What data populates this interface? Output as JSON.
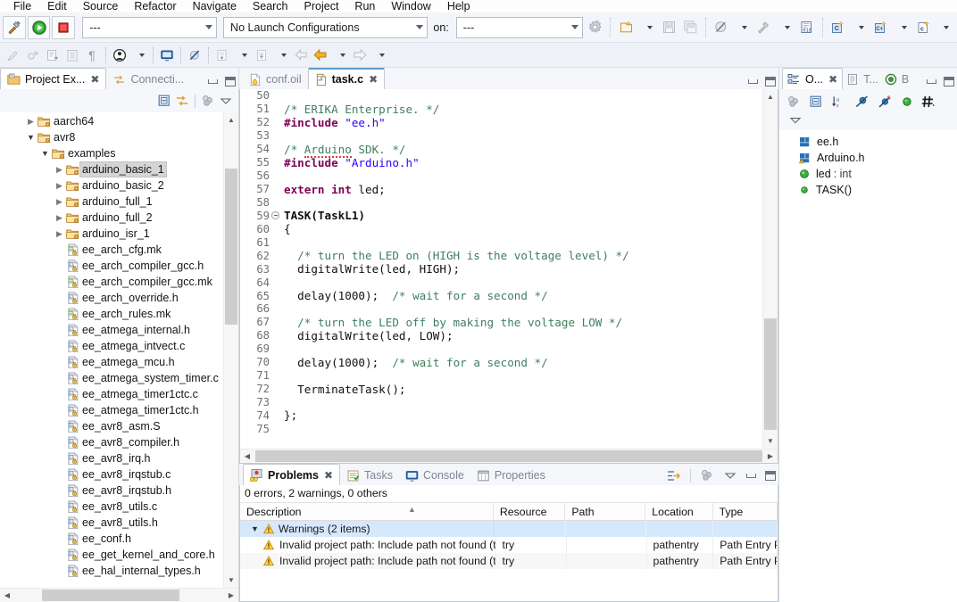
{
  "menubar": {
    "items": [
      "File",
      "Edit",
      "Source",
      "Refactor",
      "Navigate",
      "Search",
      "Project",
      "Run",
      "Window",
      "Help"
    ]
  },
  "toolbar": {
    "build_button": "build-hammer-button",
    "run_button": "run-button",
    "stop_button": "stop-button",
    "active_config": "---",
    "launch_config": "No Launch Configurations",
    "on_label": "on:",
    "on_value": "---",
    "items": [
      "new-wizard-button",
      "save-button",
      "save-all-button",
      "skip-breakpoints-button",
      "build-all-button",
      "toggle-hex-button",
      "new-c-project-button",
      "new-cpp-project-button",
      "new-c-file-button"
    ]
  },
  "toolbar2": {
    "items": [
      "marker-button",
      "new-annotation-button",
      "forward-edit-button",
      "open-type-button",
      "pilcrow-button",
      "user-button",
      "console-button",
      "skip-all-breakpoints-button",
      "previous-annotation-button",
      "next-annotation-button",
      "back-button",
      "previous-edit-button",
      "next-edit-button"
    ]
  },
  "project_explorer": {
    "tabs": [
      {
        "label": "Project Ex...",
        "icon": "project-explorer-icon",
        "active": true,
        "closable": true
      },
      {
        "label": "Connecti...",
        "icon": "connection-icon",
        "active": false,
        "closable": false
      }
    ],
    "toolbar": [
      "collapse-all-icon",
      "link-with-editor-icon",
      "view-filters-icon",
      "view-menu-icon"
    ],
    "minimize": "minimize-button",
    "maximize": "maximize-button",
    "tree": [
      {
        "label": "aarch64",
        "depth": 2,
        "type": "folder",
        "state": "collapsed",
        "selected": false
      },
      {
        "label": "avr8",
        "depth": 2,
        "type": "folder",
        "state": "expanded",
        "selected": false
      },
      {
        "label": "examples",
        "depth": 3,
        "type": "folder",
        "state": "expanded",
        "selected": false
      },
      {
        "label": "arduino_basic_1",
        "depth": 4,
        "type": "folder",
        "state": "collapsed",
        "selected": true
      },
      {
        "label": "arduino_basic_2",
        "depth": 4,
        "type": "folder",
        "state": "collapsed",
        "selected": false
      },
      {
        "label": "arduino_full_1",
        "depth": 4,
        "type": "folder",
        "state": "collapsed",
        "selected": false
      },
      {
        "label": "arduino_full_2",
        "depth": 4,
        "type": "folder",
        "state": "collapsed",
        "selected": false
      },
      {
        "label": "arduino_isr_1",
        "depth": 4,
        "type": "folder",
        "state": "collapsed",
        "selected": false
      },
      {
        "label": "ee_arch_cfg.mk",
        "depth": 4,
        "type": "mk",
        "state": "leaf",
        "selected": false
      },
      {
        "label": "ee_arch_compiler_gcc.h",
        "depth": 4,
        "type": "src",
        "state": "leaf",
        "selected": false
      },
      {
        "label": "ee_arch_compiler_gcc.mk",
        "depth": 4,
        "type": "mk",
        "state": "leaf",
        "selected": false
      },
      {
        "label": "ee_arch_override.h",
        "depth": 4,
        "type": "src",
        "state": "leaf",
        "selected": false
      },
      {
        "label": "ee_arch_rules.mk",
        "depth": 4,
        "type": "mk",
        "state": "leaf",
        "selected": false
      },
      {
        "label": "ee_atmega_internal.h",
        "depth": 4,
        "type": "src",
        "state": "leaf",
        "selected": false
      },
      {
        "label": "ee_atmega_intvect.c",
        "depth": 4,
        "type": "src",
        "state": "leaf",
        "selected": false
      },
      {
        "label": "ee_atmega_mcu.h",
        "depth": 4,
        "type": "src",
        "state": "leaf",
        "selected": false
      },
      {
        "label": "ee_atmega_system_timer.c",
        "depth": 4,
        "type": "src",
        "state": "leaf",
        "selected": false
      },
      {
        "label": "ee_atmega_timer1ctc.c",
        "depth": 4,
        "type": "src",
        "state": "leaf",
        "selected": false
      },
      {
        "label": "ee_atmega_timer1ctc.h",
        "depth": 4,
        "type": "src",
        "state": "leaf",
        "selected": false
      },
      {
        "label": "ee_avr8_asm.S",
        "depth": 4,
        "type": "asm",
        "state": "leaf",
        "selected": false
      },
      {
        "label": "ee_avr8_compiler.h",
        "depth": 4,
        "type": "src",
        "state": "leaf",
        "selected": false
      },
      {
        "label": "ee_avr8_irq.h",
        "depth": 4,
        "type": "src",
        "state": "leaf",
        "selected": false
      },
      {
        "label": "ee_avr8_irqstub.c",
        "depth": 4,
        "type": "src",
        "state": "leaf",
        "selected": false
      },
      {
        "label": "ee_avr8_irqstub.h",
        "depth": 4,
        "type": "src",
        "state": "leaf",
        "selected": false
      },
      {
        "label": "ee_avr8_utils.c",
        "depth": 4,
        "type": "src",
        "state": "leaf",
        "selected": false
      },
      {
        "label": "ee_avr8_utils.h",
        "depth": 4,
        "type": "src",
        "state": "leaf",
        "selected": false
      },
      {
        "label": "ee_conf.h",
        "depth": 4,
        "type": "src",
        "state": "leaf",
        "selected": false
      },
      {
        "label": "ee_get_kernel_and_core.h",
        "depth": 4,
        "type": "src",
        "state": "leaf",
        "selected": false
      },
      {
        "label": "ee_hal_internal_types.h",
        "depth": 4,
        "type": "src",
        "state": "leaf",
        "selected": false
      }
    ]
  },
  "editor": {
    "tabs": [
      {
        "label": "conf.oil",
        "icon": "oil-file-icon",
        "active": false,
        "closable": false
      },
      {
        "label": "task.c",
        "icon": "c-file-icon",
        "active": true,
        "closable": true
      }
    ],
    "minimize": "minimize-button",
    "maximize": "maximize-button",
    "first_visible_line": 50,
    "lines": [
      {
        "n": 50,
        "tokens": []
      },
      {
        "n": 51,
        "tokens": [
          {
            "t": "/* ERIKA Enterprise. */",
            "c": "cmt"
          }
        ]
      },
      {
        "n": 52,
        "tokens": [
          {
            "t": "#include ",
            "c": "pp"
          },
          {
            "t": "\"ee.h\"",
            "c": "str"
          }
        ]
      },
      {
        "n": 53,
        "tokens": []
      },
      {
        "n": 54,
        "tokens": [
          {
            "t": "/* ",
            "c": "cmt"
          },
          {
            "t": "Arduino",
            "c": "cmt sq"
          },
          {
            "t": " SDK. */",
            "c": "cmt"
          }
        ]
      },
      {
        "n": 55,
        "tokens": [
          {
            "t": "#include ",
            "c": "pp"
          },
          {
            "t": "\"Arduino.h\"",
            "c": "str"
          }
        ]
      },
      {
        "n": 56,
        "tokens": []
      },
      {
        "n": 57,
        "tokens": [
          {
            "t": "extern int ",
            "c": "kw"
          },
          {
            "t": "led;",
            "c": ""
          }
        ]
      },
      {
        "n": 59,
        "tokens": [
          {
            "t": "TASK(TaskL1)",
            "c": "bld"
          }
        ],
        "fold": true
      },
      {
        "n": 60,
        "tokens": [
          {
            "t": "{",
            "c": ""
          }
        ]
      },
      {
        "n": 61,
        "tokens": []
      },
      {
        "n": 62,
        "tokens": [
          {
            "t": "  /* turn the LED on (HIGH is the voltage level) */",
            "c": "cmt"
          }
        ]
      },
      {
        "n": 63,
        "tokens": [
          {
            "t": "  digitalWrite(led, HIGH);",
            "c": ""
          }
        ]
      },
      {
        "n": 64,
        "tokens": []
      },
      {
        "n": 65,
        "tokens": [
          {
            "t": "  delay(1000);  ",
            "c": ""
          },
          {
            "t": "/* wait for a second */",
            "c": "cmt"
          }
        ]
      },
      {
        "n": 66,
        "tokens": []
      },
      {
        "n": 67,
        "tokens": [
          {
            "t": "  /* turn the LED off by making the voltage LOW */",
            "c": "cmt"
          }
        ]
      },
      {
        "n": 68,
        "tokens": [
          {
            "t": "  digitalWrite(led, LOW);",
            "c": ""
          }
        ]
      },
      {
        "n": 69,
        "tokens": []
      },
      {
        "n": 70,
        "tokens": [
          {
            "t": "  delay(1000);  ",
            "c": ""
          },
          {
            "t": "/* wait for a second */",
            "c": "cmt"
          }
        ]
      },
      {
        "n": 71,
        "tokens": []
      },
      {
        "n": 72,
        "tokens": [
          {
            "t": "  TerminateTask();",
            "c": ""
          }
        ]
      },
      {
        "n": 73,
        "tokens": []
      },
      {
        "n": 74,
        "tokens": [
          {
            "t": "};",
            "c": ""
          }
        ]
      },
      {
        "n": 75,
        "tokens": []
      }
    ],
    "line_58": 58
  },
  "outline": {
    "tabs": [
      {
        "label": "O...",
        "icon": "outline-icon",
        "active": true,
        "closable": true
      },
      {
        "label": "T...",
        "icon": "task-list-icon",
        "active": false,
        "closable": false
      },
      {
        "label": "B",
        "icon": "build-targets-icon",
        "active": false,
        "closable": false
      }
    ],
    "toolbar": [
      "focus-active-task-icon",
      "collapse-all-icon",
      "sort-az-icon",
      "hide-fields-icon",
      "hide-static-icon",
      "hide-nonpublic-icon",
      "hide-macros-icon",
      "view-menu-icon"
    ],
    "minimize": "minimize-button",
    "maximize": "maximize-button",
    "items": [
      {
        "label": "ee.h",
        "kind": "include",
        "warn": false,
        "type": ""
      },
      {
        "label": "Arduino.h",
        "kind": "include",
        "warn": true,
        "type": ""
      },
      {
        "label": "led",
        "kind": "variable",
        "warn": false,
        "type": " : int"
      },
      {
        "label": "TASK()",
        "kind": "function",
        "warn": false,
        "type": ""
      }
    ]
  },
  "problems": {
    "tabs": [
      {
        "label": "Problems",
        "icon": "problems-icon",
        "active": true,
        "closable": true
      },
      {
        "label": "Tasks",
        "icon": "tasks-icon",
        "active": false,
        "closable": false
      },
      {
        "label": "Console",
        "icon": "console-icon",
        "active": false,
        "closable": false
      },
      {
        "label": "Properties",
        "icon": "properties-icon",
        "active": false,
        "closable": false
      }
    ],
    "toolbar": [
      "focus-on-selection-icon",
      "filters-icon",
      "view-menu-icon"
    ],
    "minimize": "minimize-button",
    "maximize": "maximize-button",
    "summary": "0 errors, 2 warnings, 0 others",
    "columns": [
      "Description",
      "Resource",
      "Path",
      "Location",
      "Type"
    ],
    "group": {
      "label": "Warnings (2 items)",
      "expanded": true,
      "icon": "warning-icon"
    },
    "rows": [
      {
        "description": "Invalid project path: Include path not found (try\\erika\\inc).",
        "resource": "try",
        "path": "",
        "location": "pathentry",
        "type": "Path Entry Pr..."
      },
      {
        "description": "Invalid project path: Include path not found (try\\out).",
        "resource": "try",
        "path": "",
        "location": "pathentry",
        "type": "Path Entry Pr..."
      }
    ]
  },
  "colors": {
    "folder": "#e8a33d",
    "accent_tab": "#5c9ccc",
    "comment": "#3f7f5f",
    "keyword": "#7f0055",
    "string": "#2a00ff",
    "warning": "#f0a32a",
    "selection": "#d6e8fb"
  }
}
